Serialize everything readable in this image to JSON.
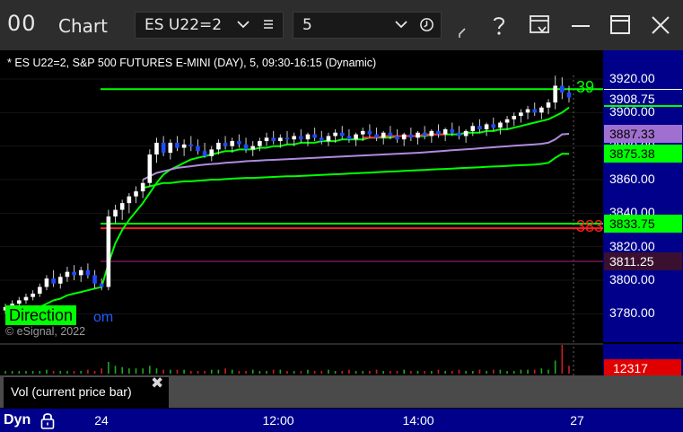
{
  "window": {
    "logo": "00",
    "title": "Chart",
    "symbol": "ES U22=2",
    "interval": "5"
  },
  "chart_data": {
    "type": "candlestick",
    "title": "* ES U22=2, S&P 500 FUTURES E-MINI (DAY), 5, 09:30-16:15 (Dynamic)",
    "y_ticks": [
      "3920.00",
      "3900.00",
      "3880.00",
      "3860.00",
      "3840.00",
      "3820.00",
      "3800.00",
      "3780.00"
    ],
    "ylim": [
      3768,
      3928
    ],
    "x_labels": [
      "24",
      "12:00",
      "14:00",
      "27"
    ],
    "price_labels": [
      {
        "text": "3908.75",
        "value": 3908.75,
        "bg": "#00008b",
        "fg": "#ffffff",
        "border": "#ffffff"
      },
      {
        "text": "3887.33",
        "value": 3887.33,
        "bg": "#a070d0",
        "fg": "#000000"
      },
      {
        "text": "3875.38",
        "value": 3875.38,
        "bg": "#00ff00",
        "fg": "#000000"
      },
      {
        "text": "3833.75",
        "value": 3833.75,
        "bg": "#00ff00",
        "fg": "#000000"
      },
      {
        "text": "3811.25",
        "value": 3811.25,
        "bg": "#3a1030",
        "fg": "#ffffff"
      }
    ],
    "edge_labels": [
      {
        "text": "39",
        "value": 3914,
        "color": "#00ff00"
      },
      {
        "text": "383",
        "value": 3831,
        "color": "#ff2020"
      }
    ],
    "horizontal_levels": [
      {
        "value": 3914,
        "color": "#00ff00"
      },
      {
        "value": 3833.75,
        "color": "#00ff00"
      },
      {
        "value": 3831,
        "color": "#ff2020"
      },
      {
        "value": 3811.25,
        "color": "#5a1040"
      }
    ],
    "candles": [
      [
        3782,
        3786,
        3780,
        3784
      ],
      [
        3784,
        3788,
        3782,
        3786
      ],
      [
        3786,
        3790,
        3784,
        3788
      ],
      [
        3788,
        3792,
        3786,
        3790
      ],
      [
        3790,
        3794,
        3788,
        3792
      ],
      [
        3792,
        3798,
        3790,
        3796
      ],
      [
        3796,
        3803,
        3794,
        3801
      ],
      [
        3801,
        3806,
        3796,
        3798
      ],
      [
        3798,
        3804,
        3795,
        3802
      ],
      [
        3802,
        3808,
        3799,
        3805
      ],
      [
        3805,
        3809,
        3800,
        3803
      ],
      [
        3803,
        3808,
        3799,
        3806
      ],
      [
        3806,
        3810,
        3801,
        3803
      ],
      [
        3803,
        3806,
        3795,
        3798
      ],
      [
        3798,
        3801,
        3794,
        3796
      ],
      [
        3796,
        3842,
        3794,
        3838
      ],
      [
        3838,
        3845,
        3834,
        3842
      ],
      [
        3842,
        3848,
        3836,
        3846
      ],
      [
        3846,
        3852,
        3840,
        3850
      ],
      [
        3850,
        3856,
        3846,
        3853
      ],
      [
        3853,
        3860,
        3849,
        3858
      ],
      [
        3858,
        3878,
        3856,
        3875
      ],
      [
        3875,
        3885,
        3870,
        3882
      ],
      [
        3882,
        3886,
        3874,
        3876
      ],
      [
        3876,
        3884,
        3872,
        3882
      ],
      [
        3882,
        3886,
        3877,
        3879
      ],
      [
        3879,
        3884,
        3874,
        3881
      ],
      [
        3881,
        3886,
        3877,
        3880
      ],
      [
        3880,
        3884,
        3875,
        3877
      ],
      [
        3877,
        3882,
        3873,
        3874
      ],
      [
        3874,
        3880,
        3871,
        3878
      ],
      [
        3878,
        3884,
        3875,
        3882
      ],
      [
        3882,
        3886,
        3878,
        3880
      ],
      [
        3880,
        3885,
        3876,
        3883
      ],
      [
        3883,
        3887,
        3879,
        3881
      ],
      [
        3881,
        3885,
        3876,
        3878
      ],
      [
        3878,
        3883,
        3874,
        3880
      ],
      [
        3880,
        3885,
        3877,
        3883
      ],
      [
        3883,
        3888,
        3880,
        3885
      ],
      [
        3885,
        3889,
        3881,
        3883
      ],
      [
        3883,
        3887,
        3879,
        3885
      ],
      [
        3885,
        3889,
        3881,
        3884
      ],
      [
        3884,
        3888,
        3880,
        3886
      ],
      [
        3886,
        3890,
        3882,
        3884
      ],
      [
        3884,
        3888,
        3880,
        3887
      ],
      [
        3887,
        3891,
        3883,
        3885
      ],
      [
        3885,
        3889,
        3881,
        3883
      ],
      [
        3883,
        3888,
        3880,
        3886
      ],
      [
        3886,
        3890,
        3882,
        3888
      ],
      [
        3888,
        3892,
        3884,
        3886
      ],
      [
        3886,
        3890,
        3882,
        3884
      ],
      [
        3884,
        3888,
        3880,
        3887
      ],
      [
        3887,
        3891,
        3883,
        3889
      ],
      [
        3889,
        3893,
        3885,
        3887
      ],
      [
        3887,
        3891,
        3883,
        3885
      ],
      [
        3885,
        3889,
        3881,
        3888
      ],
      [
        3888,
        3892,
        3884,
        3886
      ],
      [
        3886,
        3890,
        3882,
        3884
      ],
      [
        3884,
        3888,
        3880,
        3887
      ],
      [
        3887,
        3891,
        3883,
        3885
      ],
      [
        3885,
        3889,
        3881,
        3888
      ],
      [
        3888,
        3892,
        3884,
        3886
      ],
      [
        3886,
        3890,
        3882,
        3889
      ],
      [
        3889,
        3893,
        3885,
        3887
      ],
      [
        3887,
        3891,
        3883,
        3890
      ],
      [
        3890,
        3894,
        3886,
        3888
      ],
      [
        3888,
        3892,
        3884,
        3886
      ],
      [
        3886,
        3890,
        3882,
        3889
      ],
      [
        3889,
        3894,
        3886,
        3892
      ],
      [
        3892,
        3896,
        3888,
        3890
      ],
      [
        3890,
        3894,
        3886,
        3893
      ],
      [
        3893,
        3897,
        3889,
        3891
      ],
      [
        3891,
        3895,
        3887,
        3894
      ],
      [
        3894,
        3898,
        3890,
        3896
      ],
      [
        3896,
        3900,
        3892,
        3898
      ],
      [
        3898,
        3902,
        3894,
        3900
      ],
      [
        3900,
        3904,
        3896,
        3902
      ],
      [
        3902,
        3906,
        3898,
        3900
      ],
      [
        3900,
        3904,
        3896,
        3903
      ],
      [
        3903,
        3908,
        3899,
        3906
      ],
      [
        3906,
        3922,
        3902,
        3916
      ],
      [
        3916,
        3921,
        3908,
        3912
      ],
      [
        3912,
        3916,
        3906,
        3909
      ]
    ],
    "moving_averages": [
      {
        "color": "#00ff00",
        "values": [
          3778,
          3779,
          3780,
          3781,
          3782,
          3784,
          3786,
          3788,
          3789,
          3791,
          3792,
          3793,
          3794,
          3795,
          3796,
          3810,
          3822,
          3830,
          3836,
          3841,
          3846,
          3852,
          3858,
          3863,
          3866,
          3868,
          3870,
          3872,
          3873,
          3874,
          3875,
          3876,
          3877,
          3877,
          3878,
          3878,
          3878,
          3879,
          3879,
          3880,
          3880,
          3881,
          3881,
          3882,
          3882,
          3882,
          3883,
          3883,
          3883,
          3884,
          3884,
          3884,
          3884,
          3885,
          3885,
          3885,
          3885,
          3886,
          3886,
          3886,
          3886,
          3886,
          3887,
          3887,
          3887,
          3887,
          3887,
          3888,
          3888,
          3888,
          3889,
          3889,
          3890,
          3890,
          3891,
          3892,
          3893,
          3894,
          3895,
          3896,
          3898,
          3900,
          3903
        ]
      },
      {
        "color": "#ff3030",
        "values": [
          null,
          null,
          null,
          null,
          null,
          null,
          null,
          null,
          null,
          null,
          null,
          null,
          null,
          null,
          null,
          null,
          null,
          null,
          null,
          null,
          null,
          null,
          null,
          null,
          null,
          null,
          null,
          null,
          null,
          null,
          null,
          null,
          null,
          null,
          null,
          null,
          null,
          null,
          null,
          null,
          null,
          null,
          null,
          null,
          null,
          null,
          null,
          null,
          null,
          null,
          null,
          null,
          3885,
          3885,
          3885,
          3886,
          3886,
          3886,
          3886,
          3886,
          3886,
          3887,
          3887,
          3887,
          3887,
          null,
          null,
          null,
          null,
          null,
          null,
          null,
          null,
          null,
          null,
          null,
          null,
          null,
          null,
          null,
          null,
          null,
          null
        ]
      },
      {
        "color": "#b08ae0",
        "values": [
          null,
          null,
          null,
          null,
          null,
          null,
          null,
          null,
          null,
          null,
          null,
          null,
          null,
          null,
          null,
          null,
          null,
          null,
          null,
          null,
          3860,
          3862,
          3864,
          3865,
          3866,
          3867,
          3867.5,
          3868,
          3868.5,
          3869,
          3869.3,
          3869.6,
          3870,
          3870.3,
          3870.6,
          3871,
          3871.2,
          3871.4,
          3871.6,
          3871.8,
          3872,
          3872.2,
          3872.4,
          3872.6,
          3872.8,
          3873,
          3873.2,
          3873.4,
          3873.6,
          3873.8,
          3874,
          3874.2,
          3874.4,
          3874.6,
          3874.8,
          3875,
          3875.2,
          3875.4,
          3875.6,
          3875.8,
          3876,
          3876.3,
          3876.6,
          3876.9,
          3877.2,
          3877.5,
          3877.8,
          3878.1,
          3878.4,
          3878.7,
          3879,
          3879.3,
          3879.6,
          3879.9,
          3880.2,
          3880.5,
          3880.8,
          3881,
          3881.4,
          3882,
          3884,
          3887,
          3887.3
        ]
      },
      {
        "color": "#00ff00",
        "values": [
          null,
          null,
          null,
          null,
          null,
          null,
          null,
          null,
          null,
          null,
          null,
          null,
          null,
          null,
          null,
          null,
          null,
          null,
          null,
          null,
          3855,
          3856,
          3857,
          3858,
          3858,
          3858.5,
          3859,
          3859,
          3859.3,
          3859.6,
          3860,
          3860,
          3860.3,
          3860.6,
          3860.8,
          3861,
          3861,
          3861.2,
          3861.4,
          3861.6,
          3861.8,
          3862,
          3862,
          3862.2,
          3862.4,
          3862.6,
          3862.8,
          3863,
          3863.2,
          3863.4,
          3863.6,
          3863.8,
          3864,
          3864.2,
          3864.4,
          3864.6,
          3864.8,
          3865,
          3865.2,
          3865.4,
          3865.6,
          3865.8,
          3866,
          3866.2,
          3866.4,
          3866.6,
          3866.8,
          3867,
          3867.2,
          3867.4,
          3867.6,
          3867.8,
          3868,
          3868.2,
          3868.4,
          3868.6,
          3868.8,
          3869,
          3869.4,
          3870,
          3873,
          3875.38,
          3875.38
        ]
      }
    ],
    "volume": [
      2,
      2,
      2,
      2,
      2,
      2,
      3,
      2,
      2,
      2,
      2,
      2,
      3,
      2,
      4,
      9,
      6,
      5,
      4,
      4,
      4,
      6,
      4,
      3,
      3,
      3,
      3,
      2,
      2,
      2,
      3,
      3,
      4,
      3,
      2,
      2,
      3,
      2,
      2,
      3,
      3,
      2,
      2,
      2,
      3,
      2,
      2,
      3,
      2,
      2,
      3,
      2,
      2,
      2,
      3,
      2,
      2,
      2,
      3,
      2,
      2,
      2,
      2,
      3,
      2,
      2,
      3,
      2,
      2,
      3,
      2,
      3,
      3,
      2,
      2,
      3,
      3,
      3,
      4,
      3,
      10,
      22,
      6
    ],
    "volume_value": "12317"
  },
  "chart_text": {
    "direction_label": "Direction",
    "direction_tail": "om",
    "copyright": "© eSignal, 2022"
  },
  "study": {
    "label": "Vol (current price bar)",
    "close_glyph": "✖"
  },
  "timeaxis": {
    "mode": "Dyn"
  },
  "colors": {
    "axis_bg": "#00008b",
    "up_candle": "#ffffff",
    "down_candle": "#1e4bff"
  }
}
